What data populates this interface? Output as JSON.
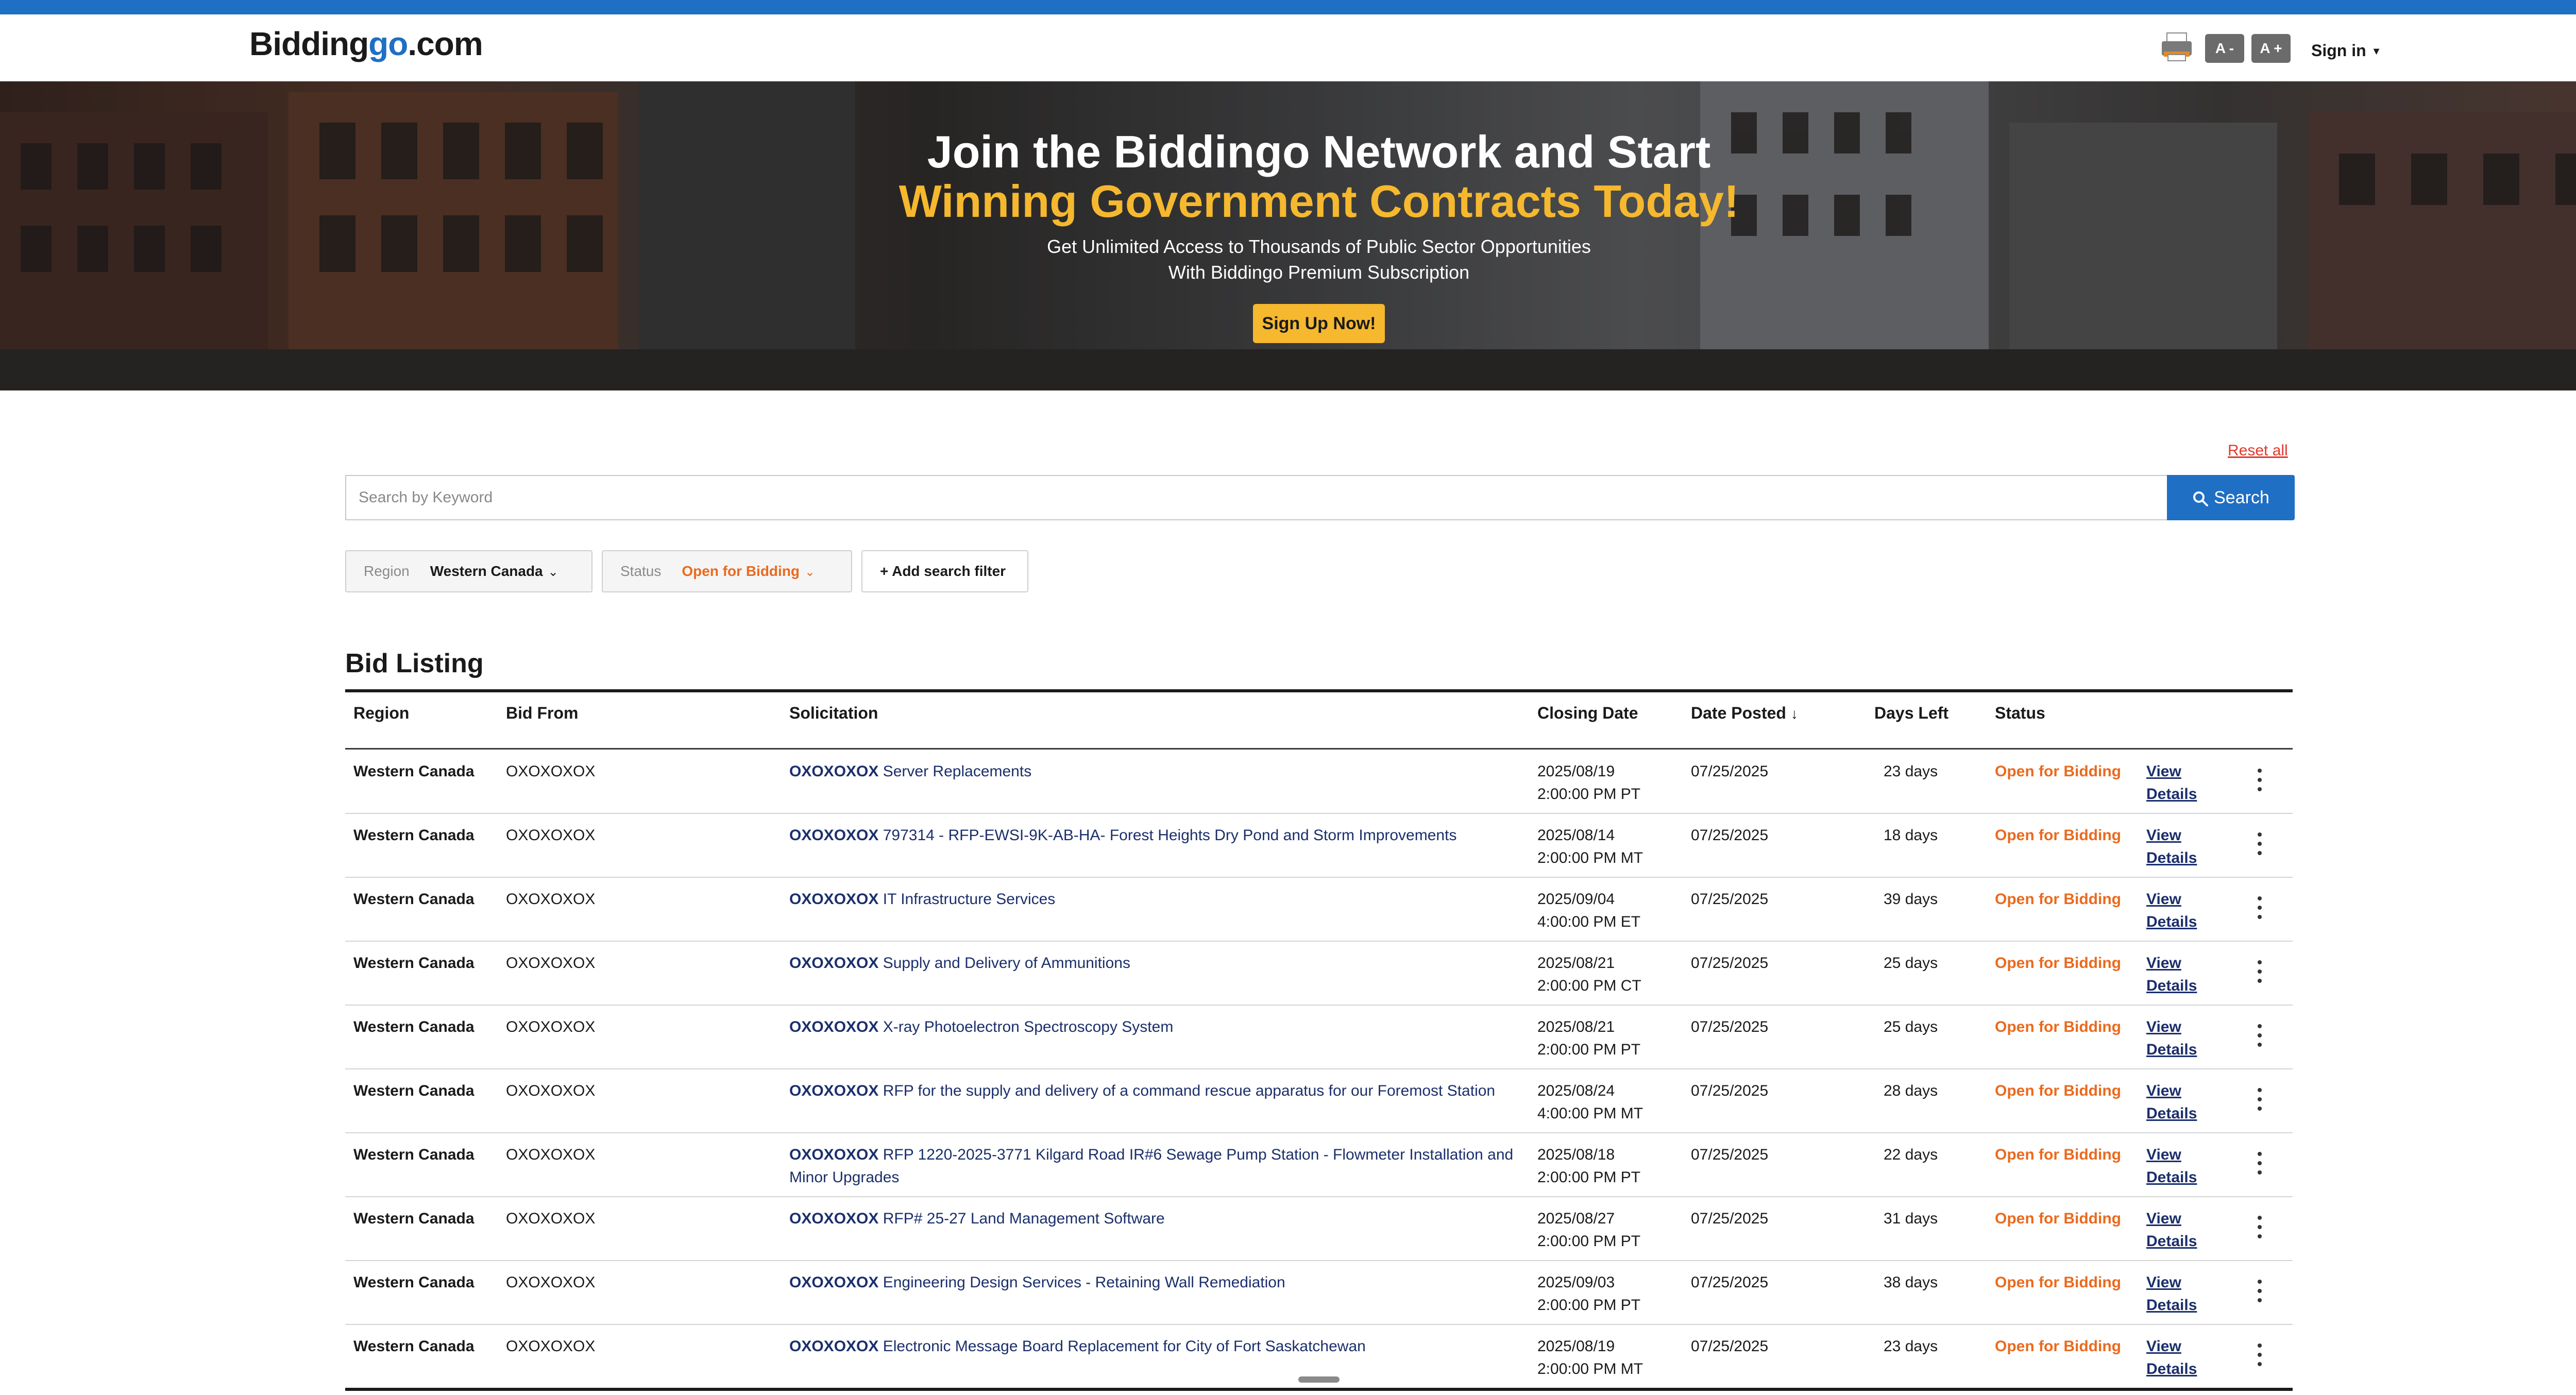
{
  "header": {
    "logo_main": "Biddingo",
    "logo_accent": "go",
    "logo_prefix": "Bidding",
    "logo_suffix": ".com",
    "font_decrease": "A -",
    "font_increase": "A +",
    "sign_in": "Sign in"
  },
  "hero": {
    "line1": "Join the Biddingo Network and Start",
    "line2": "Winning Government Contracts Today!",
    "sub1": "Get Unlimited Access to Thousands of Public Sector Opportunities",
    "sub2": "With Biddingo Premium Subscription",
    "cta": "Sign Up Now!",
    "accent_color": "#f5b82e"
  },
  "search": {
    "reset_all": "Reset all",
    "placeholder": "Search by Keyword",
    "button": "Search",
    "button_color": "#1f6fc4"
  },
  "filters": {
    "region_label": "Region",
    "region_value": "Western Canada",
    "status_label": "Status",
    "status_value": "Open for Bidding",
    "add_filter": "Add search filter"
  },
  "listing": {
    "title": "Bid Listing",
    "columns": {
      "region": "Region",
      "bid_from": "Bid From",
      "solicitation": "Solicitation",
      "closing_date": "Closing Date",
      "date_posted": "Date Posted",
      "days_left": "Days Left",
      "status": "Status"
    },
    "view_line1": "View",
    "view_line2": "Details",
    "rows": [
      {
        "region": "Western Canada",
        "bid_from": "OXOXOXOX",
        "org": "OXOXOXOX",
        "title": "Server Replacements",
        "close_date": "2025/08/19",
        "close_time": "2:00:00 PM PT",
        "posted": "07/25/2025",
        "days_left": "23 days",
        "status": "Open for Bidding"
      },
      {
        "region": "Western Canada",
        "bid_from": "OXOXOXOX",
        "org": "OXOXOXOX",
        "title": "797314 - RFP-EWSI-9K-AB-HA- Forest Heights Dry Pond and Storm Improvements",
        "close_date": "2025/08/14",
        "close_time": "2:00:00 PM MT",
        "posted": "07/25/2025",
        "days_left": "18 days",
        "status": "Open for Bidding"
      },
      {
        "region": "Western Canada",
        "bid_from": "OXOXOXOX",
        "org": "OXOXOXOX",
        "title": "IT Infrastructure Services",
        "close_date": "2025/09/04",
        "close_time": "4:00:00 PM ET",
        "posted": "07/25/2025",
        "days_left": "39 days",
        "status": "Open for Bidding"
      },
      {
        "region": "Western Canada",
        "bid_from": "OXOXOXOX",
        "org": "OXOXOXOX",
        "title": "Supply and Delivery of Ammunitions",
        "close_date": "2025/08/21",
        "close_time": "2:00:00 PM CT",
        "posted": "07/25/2025",
        "days_left": "25 days",
        "status": "Open for Bidding"
      },
      {
        "region": "Western Canada",
        "bid_from": "OXOXOXOX",
        "org": "OXOXOXOX",
        "title": "X-ray Photoelectron Spectroscopy System",
        "close_date": "2025/08/21",
        "close_time": "2:00:00 PM PT",
        "posted": "07/25/2025",
        "days_left": "25 days",
        "status": "Open for Bidding"
      },
      {
        "region": "Western Canada",
        "bid_from": "OXOXOXOX",
        "org": "OXOXOXOX",
        "title": "RFP for the supply and delivery of a command rescue apparatus for our Foremost Station",
        "close_date": "2025/08/24",
        "close_time": "4:00:00 PM MT",
        "posted": "07/25/2025",
        "days_left": "28 days",
        "status": "Open for Bidding"
      },
      {
        "region": "Western Canada",
        "bid_from": "OXOXOXOX",
        "org": "OXOXOXOX",
        "title": "RFP 1220-2025-3771 Kilgard Road IR#6 Sewage Pump Station - Flowmeter Installation and Minor Upgrades",
        "close_date": "2025/08/18",
        "close_time": "2:00:00 PM PT",
        "posted": "07/25/2025",
        "days_left": "22 days",
        "status": "Open for Bidding"
      },
      {
        "region": "Western Canada",
        "bid_from": "OXOXOXOX",
        "org": "OXOXOXOX",
        "title": "RFP# 25-27 Land Management Software",
        "close_date": "2025/08/27",
        "close_time": "2:00:00 PM PT",
        "posted": "07/25/2025",
        "days_left": "31 days",
        "status": "Open for Bidding"
      },
      {
        "region": "Western Canada",
        "bid_from": "OXOXOXOX",
        "org": "OXOXOXOX",
        "title": "Engineering Design Services - Retaining Wall Remediation",
        "close_date": "2025/09/03",
        "close_time": "2:00:00 PM PT",
        "posted": "07/25/2025",
        "days_left": "38 days",
        "status": "Open for Bidding"
      },
      {
        "region": "Western Canada",
        "bid_from": "OXOXOXOX",
        "org": "OXOXOXOX",
        "title": "Electronic Message Board Replacement for City of Fort Saskatchewan",
        "close_date": "2025/08/19",
        "close_time": "2:00:00 PM MT",
        "posted": "07/25/2025",
        "days_left": "23 days",
        "status": "Open for Bidding"
      }
    ]
  },
  "colors": {
    "brand_blue": "#1f6fc4",
    "status_orange": "#ea6a1e",
    "link_navy": "#1b2f6b"
  }
}
